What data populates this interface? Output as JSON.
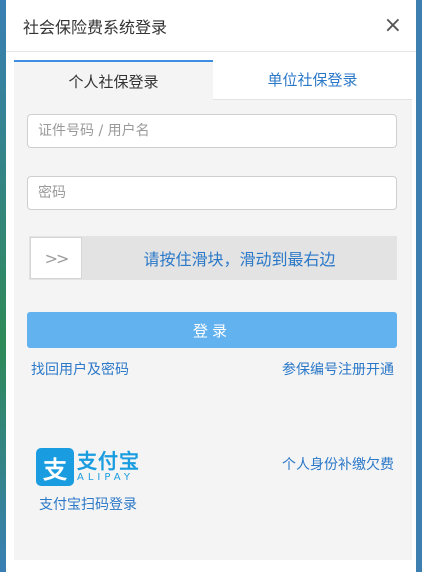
{
  "dialog": {
    "title": "社会保险费系统登录",
    "close_symbol": "×"
  },
  "tabs": [
    {
      "label": "个人社保登录",
      "active": true
    },
    {
      "label": "单位社保登录",
      "active": false
    }
  ],
  "form": {
    "username_placeholder": "证件号码 / 用户名",
    "password_placeholder": "密码",
    "slider_handle": ">>",
    "slider_text": "请按住滑块，滑动到最右边",
    "login_label": "登录"
  },
  "links": {
    "recover": "找回用户及密码",
    "register": "参保编号注册开通",
    "supplement": "个人身份补缴欠费",
    "alipay_login": "支付宝扫码登录"
  },
  "alipay": {
    "mark": "支",
    "brand_cn": "支付宝",
    "brand_en": "ALIPAY"
  },
  "colors": {
    "accent": "#63b2f0",
    "link": "#2b78c8",
    "alipay": "#1a9de0"
  }
}
